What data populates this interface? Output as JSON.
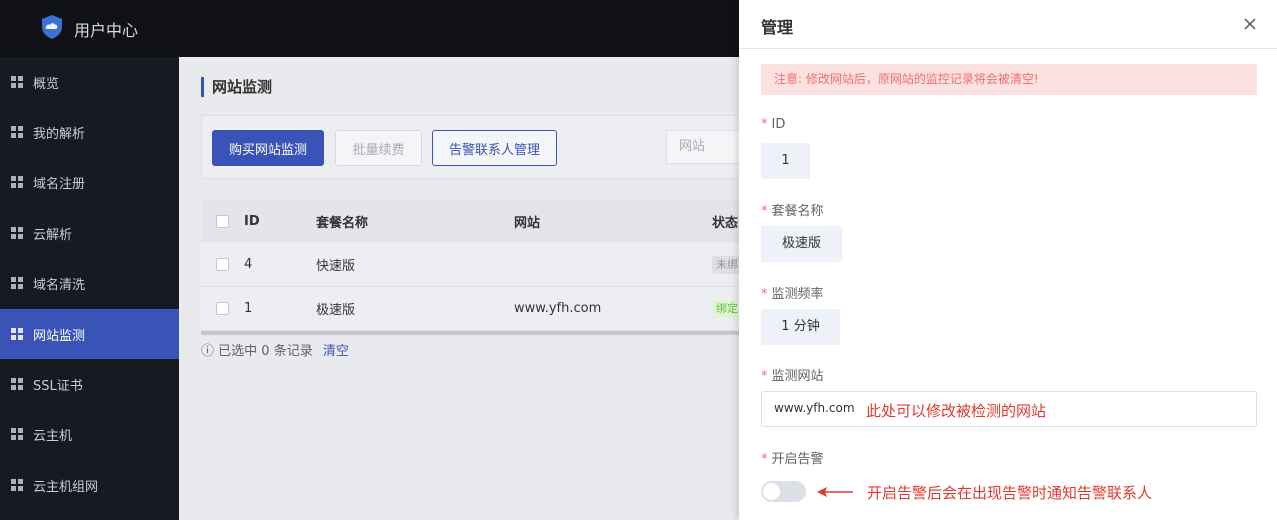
{
  "header": {
    "app_title": "用户中心",
    "logo": "cloud-shield-logo"
  },
  "sidebar": {
    "items": [
      {
        "label": "概览",
        "active": false
      },
      {
        "label": "我的解析",
        "active": false
      },
      {
        "label": "域名注册",
        "active": false
      },
      {
        "label": "云解析",
        "active": false
      },
      {
        "label": "域名清洗",
        "active": false
      },
      {
        "label": "网站监测",
        "active": true
      },
      {
        "label": "SSL证书",
        "active": false
      },
      {
        "label": "云主机",
        "active": false
      },
      {
        "label": "云主机组网",
        "active": false
      }
    ]
  },
  "main": {
    "page_title": "网站监测",
    "toolbar": {
      "buy_label": "购买网站监测",
      "renew_label": "批量续费",
      "contacts_label": "告警联系人管理",
      "search_placeholder": "网站"
    },
    "table": {
      "columns": [
        "ID",
        "套餐名称",
        "网站",
        "状态"
      ],
      "rows": [
        {
          "id": "4",
          "plan": "快速版",
          "site": "",
          "status": "未绑"
        },
        {
          "id": "1",
          "plan": "极速版",
          "site": "www.yfh.com",
          "status": "绑定"
        }
      ]
    },
    "selection": {
      "text": "已选中 0 条记录",
      "clear_label": "清空"
    }
  },
  "drawer": {
    "title": "管理",
    "alert": "注意: 修改网站后，原网站的监控记录将会被清空!",
    "fields": {
      "id_label": "ID",
      "id_value": "1",
      "plan_label": "套餐名称",
      "plan_value": "极速版",
      "freq_label": "监测频率",
      "freq_value": "1 分钟",
      "site_label": "监测网站",
      "site_value": "www.yfh.com",
      "alarm_label": "开启告警",
      "alarm_enabled": false
    },
    "annotations": {
      "site_note": "此处可以修改被检测的网站",
      "alarm_note": "开启告警后会在出现告警时通知告警联系人"
    }
  },
  "colors": {
    "accent": "#3a53b6",
    "sidebar_bg": "#181a21",
    "alert_bg": "#fde2e2",
    "annotation": "#e03a2f"
  }
}
